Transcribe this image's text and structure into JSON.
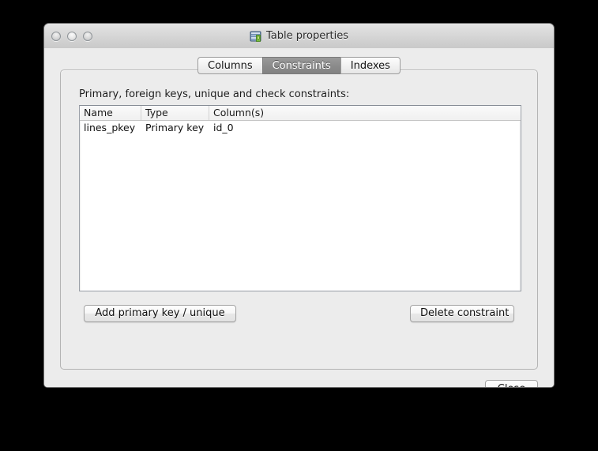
{
  "window": {
    "title": "Table properties",
    "title_icon": "database-table-icon",
    "controls": [
      {
        "name": "close-window-button",
        "label": ""
      },
      {
        "name": "minimize-window-button",
        "label": ""
      },
      {
        "name": "zoom-window-button",
        "label": ""
      }
    ]
  },
  "tabs": [
    {
      "label": "Columns",
      "selected": false
    },
    {
      "label": "Constraints",
      "selected": true
    },
    {
      "label": "Indexes",
      "selected": false
    }
  ],
  "panel": {
    "label": "Primary, foreign keys, unique and check constraints:"
  },
  "list": {
    "columns": [
      "Name",
      "Type",
      "Column(s)"
    ],
    "rows": [
      {
        "name": "lines_pkey",
        "type": "Primary key",
        "columns": "id_0"
      }
    ]
  },
  "buttons": {
    "add": "Add primary key / unique",
    "delete": "Delete constraint",
    "close": "Close"
  },
  "colors": {
    "window_background": "#ececec",
    "selected_tab": "#8c8c8c",
    "list_background": "#ffffff",
    "desktop": "#000000"
  }
}
